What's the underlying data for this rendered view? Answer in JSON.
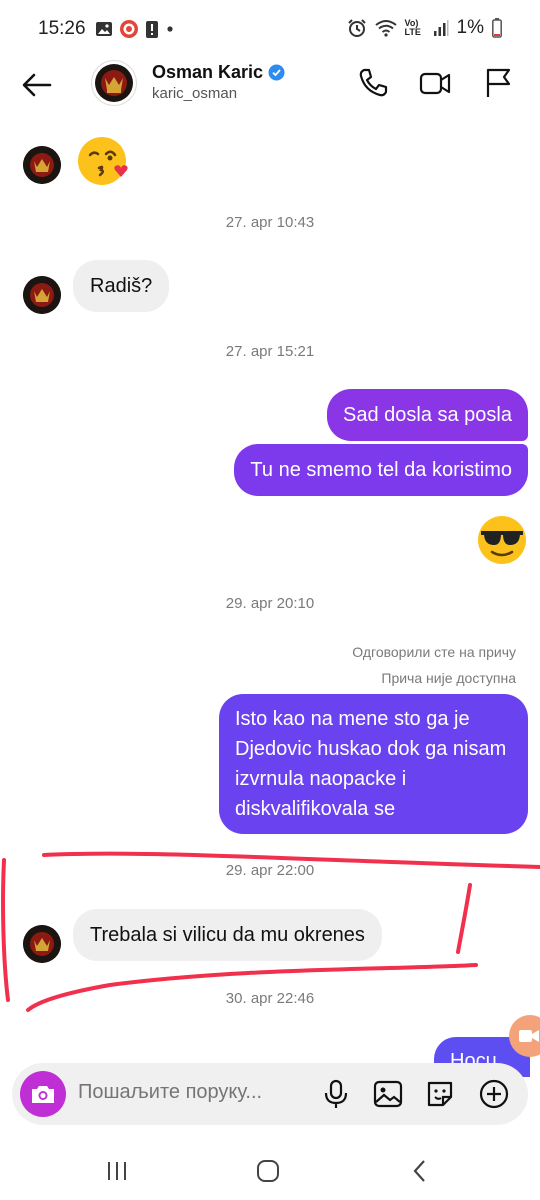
{
  "status_bar": {
    "time": "15:26",
    "battery": "1%",
    "network": "Vo) LTE"
  },
  "header": {
    "name": "Osman Karic",
    "username": "karic_osman",
    "icons": [
      "back-arrow-icon",
      "verified-badge-icon",
      "phone-icon",
      "video-icon",
      "flag-icon"
    ]
  },
  "messages": {
    "ts1": "27. apr 10:43",
    "in1": "Radiš?",
    "ts2": "27. apr 15:21",
    "out1": "Sad dosla sa posla",
    "out2": "Tu ne smemo tel da koristimo",
    "ts3": "29. apr 20:10",
    "reply_meta": "Одговорили сте на причу",
    "story_meta": "Прича није доступна",
    "out3": "Isto kao na mene sto ga je Djedovic huskao dok ga nisam izvrnula naopacke i diskvalifikovala se",
    "ts4": "29. apr 22:00",
    "in2": "Trebala si vilicu da mu okrenes",
    "ts5": "30. apr 22:46",
    "out4_partial": "Hocu"
  },
  "composer": {
    "placeholder": "Пошаљите поруку..."
  },
  "colors": {
    "bubble_out_top": "#8a35e6",
    "bubble_out_bottom": "#6b42f0",
    "bubble_in": "#efefef",
    "camera_button": "#c02fd6",
    "annotation_red": "#f0304d"
  }
}
